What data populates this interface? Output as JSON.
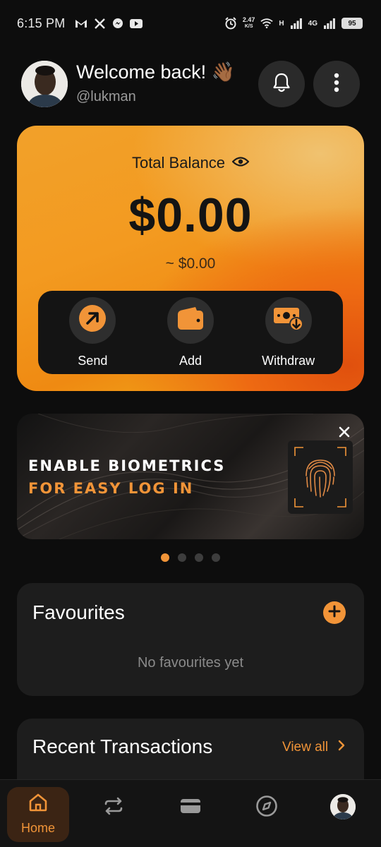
{
  "status_bar": {
    "time": "6:15 PM",
    "speed_value": "2.47",
    "speed_unit": "K/S",
    "net_h": "H",
    "net_4g": "4G",
    "battery": "95",
    "left_icons": [
      "gmail-icon",
      "x-icon",
      "messenger-icon",
      "youtube-icon"
    ],
    "right_icons": [
      "alarm-icon",
      "wifi-icon",
      "signal-icon",
      "signal-icon"
    ]
  },
  "header": {
    "welcome": "Welcome back! 👋🏾",
    "username": "@lukman"
  },
  "balance": {
    "label": "Total Balance",
    "amount": "$0.00",
    "converted": "~ $0.00",
    "actions": [
      {
        "label": "Send",
        "icon": "arrow-up-right-icon"
      },
      {
        "label": "Add",
        "icon": "wallet-icon"
      },
      {
        "label": "Withdraw",
        "icon": "cash-withdraw-icon"
      }
    ]
  },
  "banner": {
    "line1": "ENABLE BIOMETRICS",
    "line2": "FOR EASY LOG IN",
    "carousel_count": 4,
    "carousel_active": 1
  },
  "favourites": {
    "title": "Favourites",
    "empty_text": "No favourites yet"
  },
  "recent": {
    "title": "Recent Transactions",
    "view_all": "View all"
  },
  "nav": {
    "home": "Home",
    "items": [
      "home-icon",
      "transfer-icon",
      "card-icon",
      "compass-icon",
      "profile-avatar"
    ]
  },
  "colors": {
    "accent": "#f19438",
    "background": "#0d0d0d",
    "card": "#1d1d1d"
  }
}
